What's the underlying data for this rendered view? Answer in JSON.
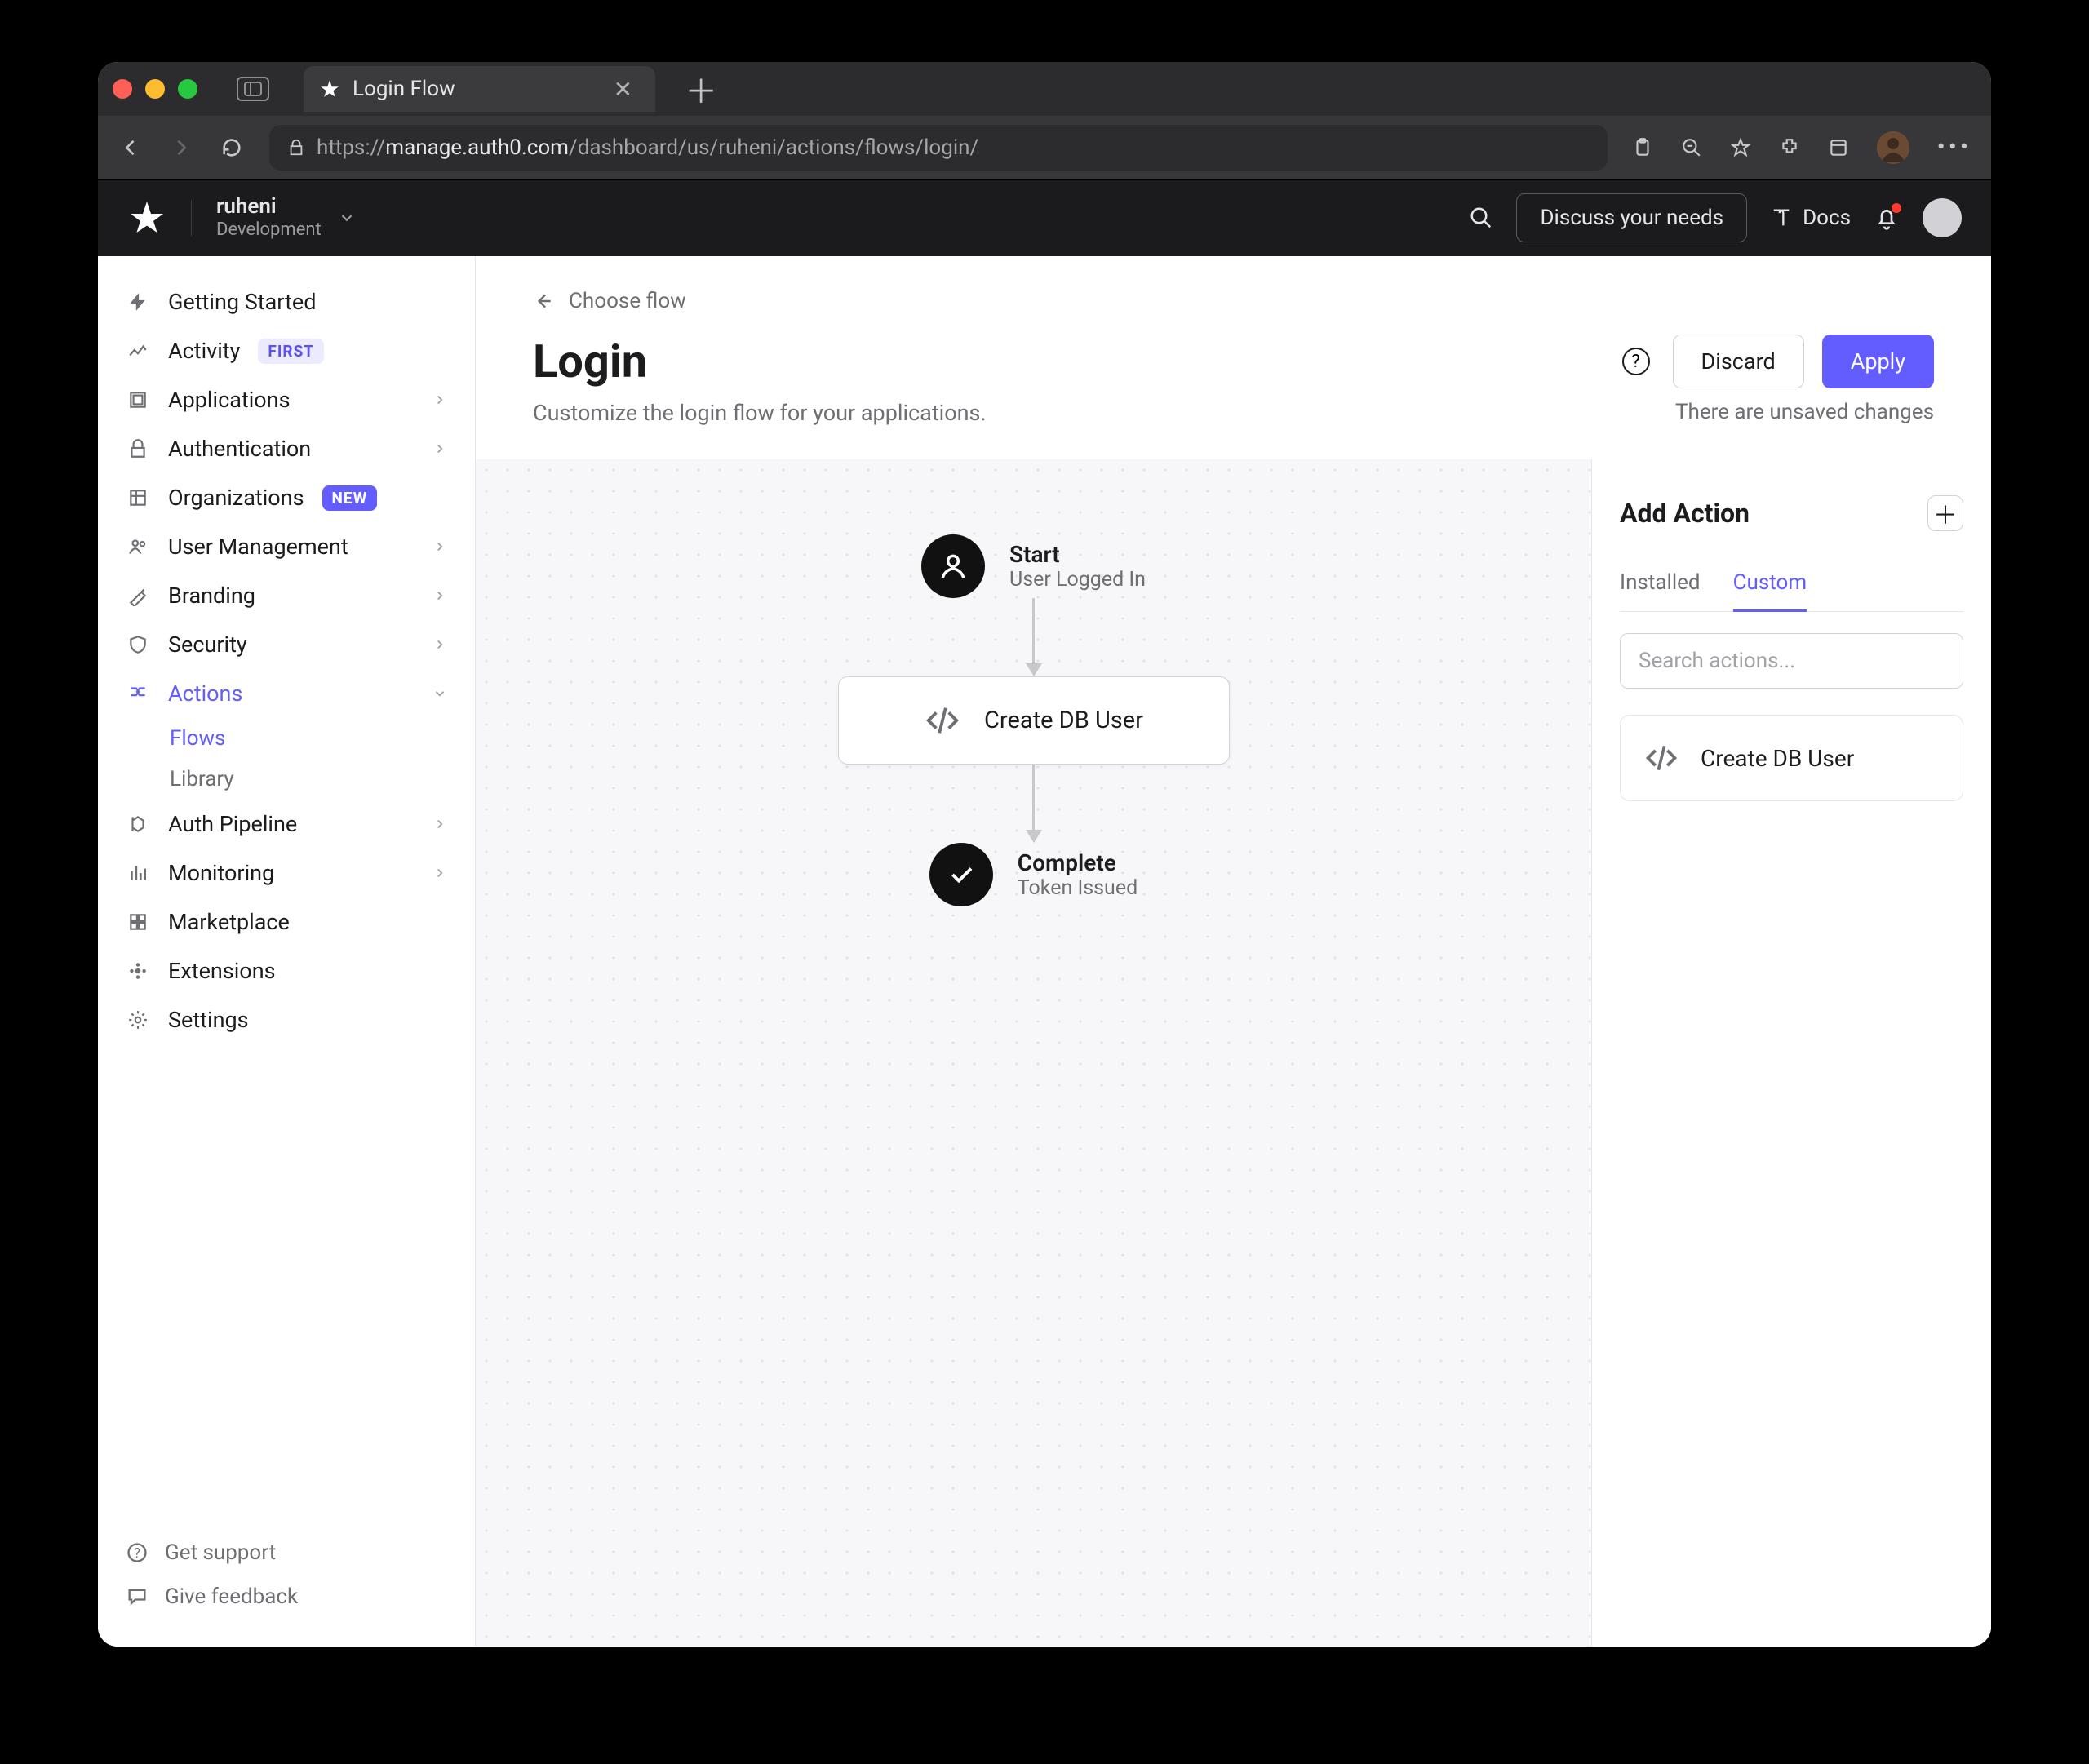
{
  "browser": {
    "tab_title": "Login Flow",
    "url_prefix": "https://",
    "url_host": "manage.auth0.com",
    "url_path": "/dashboard/us/ruheni/actions/flows/login/"
  },
  "appbar": {
    "tenant_name": "ruheni",
    "tenant_env": "Development",
    "discuss": "Discuss your needs",
    "docs": "Docs"
  },
  "sidebar": {
    "items": [
      {
        "label": "Getting Started"
      },
      {
        "label": "Activity",
        "badge": "FIRST",
        "badge_kind": "first"
      },
      {
        "label": "Applications",
        "chev": true
      },
      {
        "label": "Authentication",
        "chev": true
      },
      {
        "label": "Organizations",
        "badge": "NEW",
        "badge_kind": "new"
      },
      {
        "label": "User Management",
        "chev": true
      },
      {
        "label": "Branding",
        "chev": true
      },
      {
        "label": "Security",
        "chev": true
      },
      {
        "label": "Actions",
        "chev": true,
        "active": true
      },
      {
        "label": "Auth Pipeline",
        "chev": true
      },
      {
        "label": "Monitoring",
        "chev": true
      },
      {
        "label": "Marketplace"
      },
      {
        "label": "Extensions"
      },
      {
        "label": "Settings"
      }
    ],
    "subitems": [
      {
        "label": "Flows",
        "active": true
      },
      {
        "label": "Library",
        "active": false
      }
    ],
    "footer": {
      "support": "Get support",
      "feedback": "Give feedback"
    }
  },
  "page": {
    "back": "Choose flow",
    "title": "Login",
    "subtitle": "Customize the login flow for your applications.",
    "discard": "Discard",
    "apply": "Apply",
    "unsaved": "There are unsaved changes"
  },
  "flow": {
    "start_title": "Start",
    "start_sub": "User Logged In",
    "action_label": "Create DB User",
    "end_title": "Complete",
    "end_sub": "Token Issued"
  },
  "panel": {
    "title": "Add Action",
    "tab_installed": "Installed",
    "tab_custom": "Custom",
    "search_placeholder": "Search actions...",
    "card_label": "Create DB User"
  }
}
